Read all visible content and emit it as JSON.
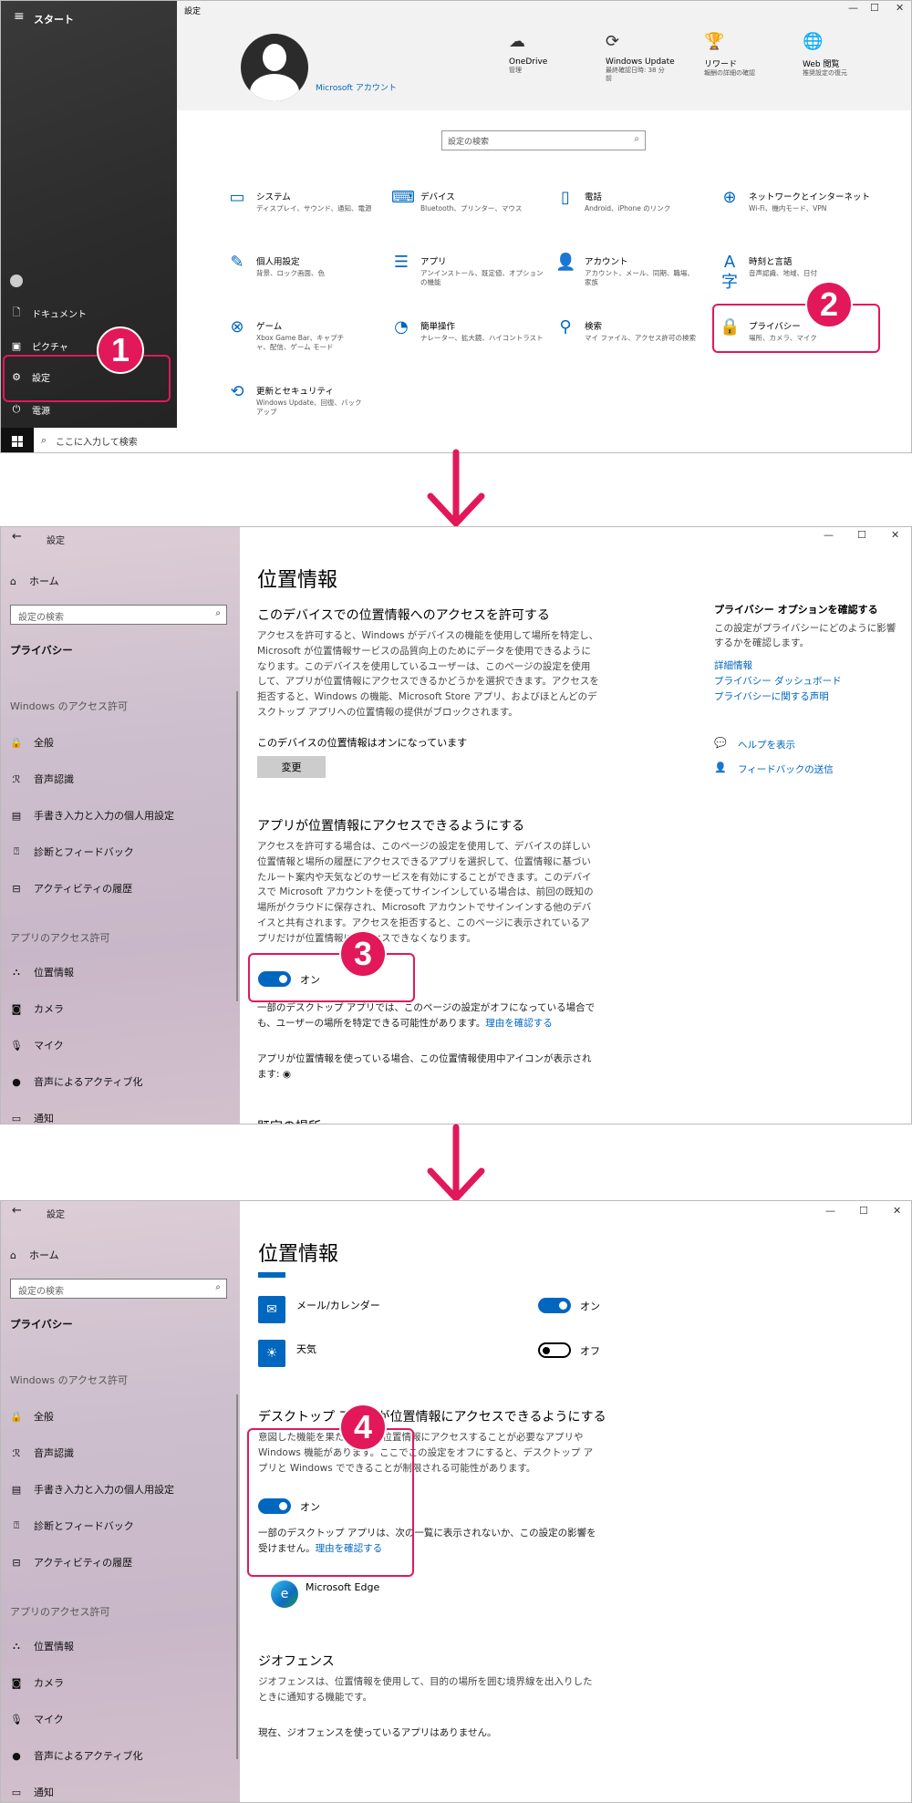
{
  "panel1": {
    "start": {
      "title": "スタート",
      "items": [
        {
          "label": "ドキュメント"
        },
        {
          "label": "ピクチャ"
        },
        {
          "label": "設定"
        },
        {
          "label": "電源"
        }
      ],
      "search_placeholder": "ここに入力して検索"
    },
    "settings": {
      "window_title": "設定",
      "account_link": "Microsoft アカウント",
      "header_items": [
        {
          "name": "OneDrive",
          "sub": "管理"
        },
        {
          "name": "Windows Update",
          "sub": "最終確認日時: 38 分前"
        },
        {
          "name": "リワード",
          "sub": "報酬の詳細の確認"
        },
        {
          "name": "Web 閲覧",
          "sub": "推奨設定の復元"
        }
      ],
      "search_placeholder": "設定の検索",
      "categories": [
        {
          "name": "システム",
          "sub": "ディスプレイ、サウンド、通知、電源"
        },
        {
          "name": "デバイス",
          "sub": "Bluetooth、プリンター、マウス"
        },
        {
          "name": "電話",
          "sub": "Android、iPhone のリンク"
        },
        {
          "name": "ネットワークとインターネット",
          "sub": "Wi-Fi、機内モード、VPN"
        },
        {
          "name": "個人用設定",
          "sub": "背景、ロック画面、色"
        },
        {
          "name": "アプリ",
          "sub": "アンインストール、既定値、オプションの機能"
        },
        {
          "name": "アカウント",
          "sub": "アカウント、メール、同期、職場、家族"
        },
        {
          "name": "時刻と言語",
          "sub": "音声認識、地域、日付"
        },
        {
          "name": "ゲーム",
          "sub": "Xbox Game Bar、キャプチャ、配信、ゲーム モード"
        },
        {
          "name": "簡単操作",
          "sub": "ナレーター、拡大鏡、ハイコントラスト"
        },
        {
          "name": "検索",
          "sub": "マイ ファイル、アクセス許可の検索"
        },
        {
          "name": "プライバシー",
          "sub": "場所、カメラ、マイク"
        },
        {
          "name": "更新とセキュリティ",
          "sub": "Windows Update、回復、バックアップ"
        }
      ]
    },
    "badges": [
      "1",
      "2"
    ]
  },
  "nav": {
    "window_title": "設定",
    "home": "ホーム",
    "search_placeholder": "設定の検索",
    "current": "プライバシー",
    "group1": "Windows のアクセス許可",
    "group1_items": [
      "全般",
      "音声認識",
      "手書き入力と入力の個人用設定",
      "診断とフィードバック",
      "アクティビティの履歴"
    ],
    "group2": "アプリのアクセス許可",
    "group2_items": [
      "位置情報",
      "カメラ",
      "マイク",
      "音声によるアクティブ化",
      "通知"
    ]
  },
  "panel2": {
    "title": "位置情報",
    "section1": {
      "heading": "このデバイスでの位置情報へのアクセスを許可する",
      "body": "アクセスを許可すると、Windows がデバイスの機能を使用して場所を特定し、Microsoft が位置情報サービスの品質向上のためにデータを使用できるようになります。このデバイスを使用しているユーザーは、このページの設定を使用して、アプリが位置情報にアクセスできるかどうかを選択できます。アクセスを拒否すると、Windows の機能、Microsoft Store アプリ、およびほとんどのデスクトップ アプリへの位置情報の提供がブロックされます。",
      "status": "このデバイスの位置情報はオンになっています",
      "button": "変更"
    },
    "section2": {
      "heading": "アプリが位置情報にアクセスできるようにする",
      "body": "アクセスを許可する場合は、このページの設定を使用して、デバイスの詳しい位置情報と場所の履歴にアクセスできるアプリを選択して、位置情報に基づいたルート案内や天気などのサービスを有効にすることができます。このデバイスで Microsoft アカウントを使ってサインインしている場合は、前回の既知の場所がクラウドに保存され、Microsoft アカウントでサインインする他のデバイスと共有されます。アクセスを拒否すると、このページに表示されているアプリだけが位置情報にアクセスできなくなります。",
      "toggle_label": "オン",
      "note": "一部のデスクトップ アプリでは、このページの設定がオフになっている場合でも、ユーザーの場所を特定できる可能性があります。",
      "note_link": "理由を確認する",
      "icon_note": "アプリが位置情報を使っている場合、この位置情報使用中アイコンが表示されます: ◉",
      "cut_heading": "既定の場所"
    },
    "side": {
      "heading": "プライバシー オプションを確認する",
      "body": "この設定がプライバシーにどのように影響するかを確認します。",
      "links": [
        "詳細情報",
        "プライバシー ダッシュボード",
        "プライバシーに関する声明"
      ],
      "help": "ヘルプを表示",
      "feedback": "フィードバックの送信"
    },
    "badge": "3"
  },
  "panel3": {
    "title": "位置情報",
    "apps": [
      {
        "name": "メール/カレンダー",
        "state": "オン",
        "on": true
      },
      {
        "name": "天気",
        "state": "オフ",
        "on": false
      }
    ],
    "desktop_heading": "デスクトップ アプリが位置情報にアクセスできるようにする",
    "desktop_body": "意図した機能を果たすために位置情報にアクセスすることが必要なアプリや Windows 機能があります。ここでこの設定をオフにすると、デスクトップ アプリと Windows でできることが制限される可能性があります。",
    "toggle_label": "オン",
    "note": "一部のデスクトップ アプリは、次の一覧に表示されないか、この設定の影響を受けません。",
    "note_link": "理由を確認する",
    "edge": "Microsoft Edge",
    "geo_heading": "ジオフェンス",
    "geo_body": "ジオフェンスは、位置情報を使用して、目的の場所を囲む境界線を出入りしたときに通知する機能です。",
    "geo_none": "現在、ジオフェンスを使っているアプリはありません。",
    "badge": "4"
  },
  "colors": {
    "accent": "#0067c0",
    "callout": "#e2185a"
  }
}
